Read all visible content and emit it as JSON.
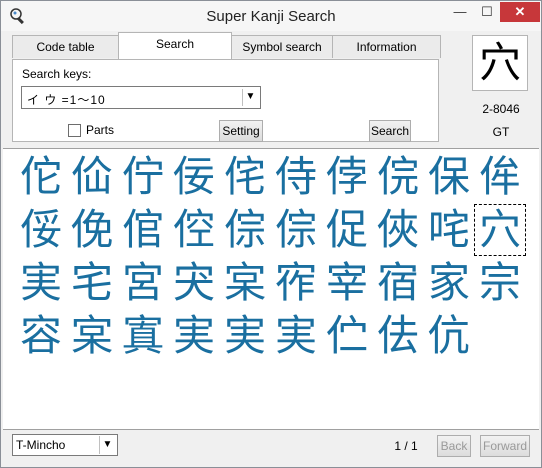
{
  "window": {
    "title": "Super Kanji Search",
    "minimize": "—",
    "maximize": "☐",
    "close": "✕"
  },
  "tabs": [
    {
      "label": "Code table"
    },
    {
      "label": "Search"
    },
    {
      "label": "Symbol search"
    },
    {
      "label": "Information"
    }
  ],
  "search": {
    "keys_label": "Search keys:",
    "keys_value": "イ ウ  =1〜10",
    "parts_label": "Parts",
    "parts_checked": false,
    "setting_label": "Setting",
    "search_label": "Search"
  },
  "preview": {
    "glyph": "穴",
    "code": "2-8046",
    "grade": "GT"
  },
  "results": [
    [
      "佗",
      "佡",
      "佇",
      "佞",
      "侘",
      "侍",
      "侼",
      "俒",
      "保",
      "侔"
    ],
    [
      "俀",
      "俛",
      "倌",
      "倥",
      "倧",
      "倧",
      "促",
      "俠",
      "咤",
      "穴"
    ],
    [
      "実",
      "宅",
      "宮",
      "宊",
      "宲",
      "宱",
      "宰",
      "宿",
      "家",
      "宗"
    ],
    [
      "容",
      "宲",
      "寘",
      "実",
      "実",
      "実",
      "伫",
      "佉",
      "伉"
    ]
  ],
  "selected_index": 19,
  "footer": {
    "font": "T-Mincho",
    "page": "1 / 1",
    "back": "Back",
    "forward": "Forward"
  },
  "colors": {
    "kanji": "#1a6fa0",
    "close_button": "#c7373a"
  }
}
